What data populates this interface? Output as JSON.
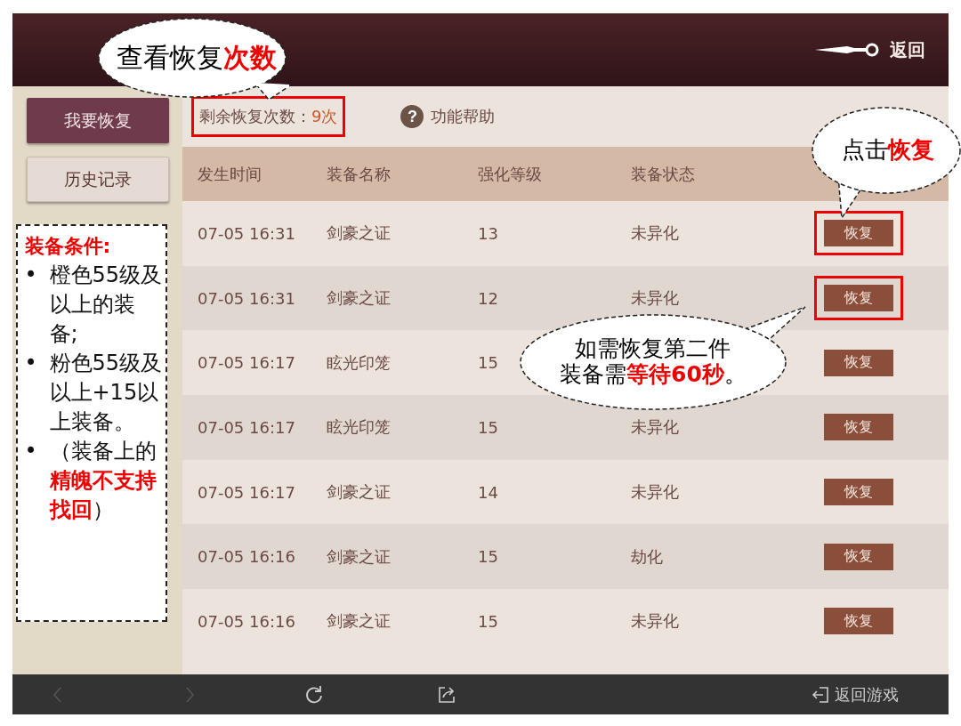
{
  "header": {
    "back_label": "返回"
  },
  "sidebar": {
    "items": [
      {
        "label": "我要恢复",
        "selected": true
      },
      {
        "label": "历史记录",
        "selected": false
      }
    ],
    "note": {
      "title": "装备条件:",
      "items": [
        {
          "bullet": "•",
          "text": "橙色55级及以上的装备;"
        },
        {
          "bullet": "•",
          "text": "粉色55级及以上+15以上装备。"
        },
        {
          "bullet": "•",
          "text": "（装备上的**精魄不支持找回**）"
        }
      ]
    }
  },
  "toolbar": {
    "count_label": "剩余恢复次数：",
    "count_value": "9次",
    "count_highlighted": true,
    "help_label": "功能帮助",
    "help_glyph": "?"
  },
  "table": {
    "columns": [
      "发生时间",
      "装备名称",
      "强化等级",
      "装备状态"
    ],
    "rows": [
      {
        "time": "07-05 16:31",
        "name": "剑豪之证",
        "level": "13",
        "status": "未异化",
        "action": "恢复",
        "highlighted": true
      },
      {
        "time": "07-05 16:31",
        "name": "剑豪之证",
        "level": "12",
        "status": "未异化",
        "action": "恢复",
        "highlighted": true
      },
      {
        "time": "07-05 16:17",
        "name": "眩光印笼",
        "level": "15",
        "action": "恢复",
        "highlighted": false
      },
      {
        "time": "07-05 16:17",
        "name": "眩光印笼",
        "level": "15",
        "status": "未异化",
        "action": "恢复",
        "highlighted": false
      },
      {
        "time": "07-05 16:17",
        "name": "剑豪之证",
        "level": "14",
        "status": "未异化",
        "action": "恢复",
        "highlighted": false
      },
      {
        "time": "07-05 16:16",
        "name": "剑豪之证",
        "level": "15",
        "status": "劫化",
        "action": "恢复",
        "highlighted": false
      },
      {
        "time": "07-05 16:16",
        "name": "剑豪之证",
        "level": "15",
        "status": "未异化",
        "action": "恢复",
        "highlighted": false
      }
    ]
  },
  "bottom_bar": {
    "back_disabled": true,
    "forward_disabled": true,
    "exit_label": "返回游戏"
  },
  "annotations": [
    {
      "kind": "count",
      "lines": [
        "查看恢复**次数**"
      ]
    },
    {
      "kind": "click",
      "lines": [
        "点击**恢复**"
      ]
    },
    {
      "kind": "wait",
      "lines": [
        "如需恢复第二件",
        "装备需**等待60秒**。"
      ]
    }
  ]
}
